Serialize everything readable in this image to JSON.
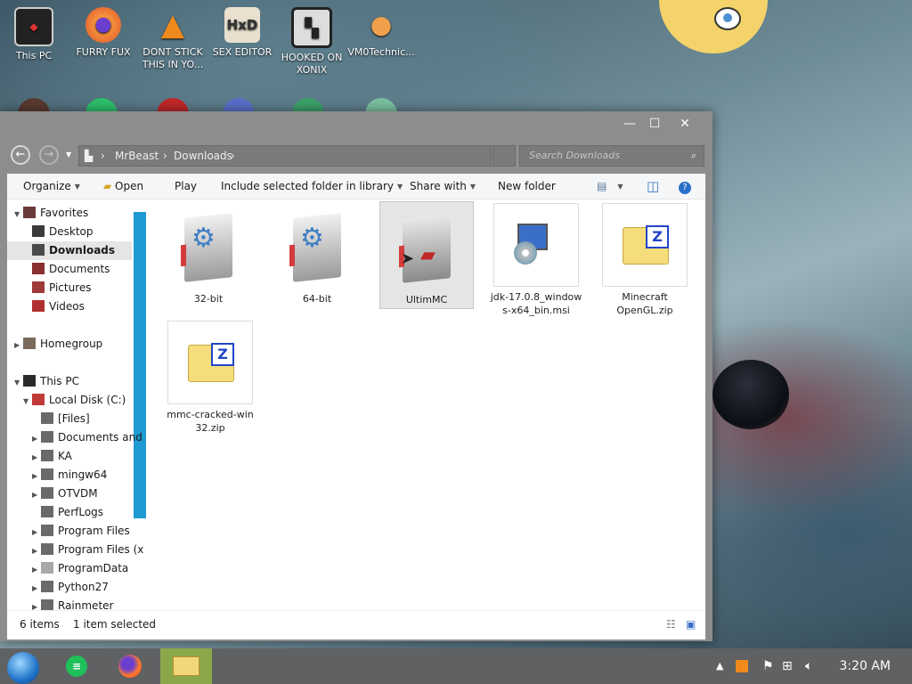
{
  "desktop": {
    "icons": [
      {
        "label": "This PC"
      },
      {
        "label": "FURRY FUX"
      },
      {
        "label": "DONT STICK THIS IN YO..."
      },
      {
        "label": "SEX EDITOR"
      },
      {
        "label": "HOOKED ON XONIX"
      },
      {
        "label": "VM0Technic..."
      }
    ]
  },
  "window": {
    "caption": {
      "minimize": "—",
      "maximize": "☐",
      "close": "✕"
    },
    "address": {
      "root": "MrBeast",
      "folder": "Downloads",
      "sep": "›"
    },
    "search_placeholder": "Search Downloads",
    "toolbar": {
      "organize": "Organize",
      "open": "Open",
      "play": "Play",
      "include": "Include selected folder in library",
      "share": "Share with",
      "new_folder": "New folder"
    },
    "tree": [
      {
        "label": "Favorites",
        "level": 0,
        "exp": "▼"
      },
      {
        "label": "Desktop",
        "level": 1,
        "exp": ""
      },
      {
        "label": "Downloads",
        "level": 1,
        "exp": "",
        "selected": true
      },
      {
        "label": "Documents",
        "level": 1,
        "exp": ""
      },
      {
        "label": "Pictures",
        "level": 1,
        "exp": ""
      },
      {
        "label": "Videos",
        "level": 1,
        "exp": ""
      },
      {
        "label": "Homegroup",
        "level": 0,
        "exp": "▶"
      },
      {
        "label": "This PC",
        "level": 0,
        "exp": "▼"
      },
      {
        "label": "Local Disk (C:)",
        "level": 1,
        "exp": "▼"
      },
      {
        "label": "[Files]",
        "level": 2,
        "exp": ""
      },
      {
        "label": "Documents and",
        "level": 2,
        "exp": "▶"
      },
      {
        "label": "KA",
        "level": 2,
        "exp": "▶"
      },
      {
        "label": "mingw64",
        "level": 2,
        "exp": "▶"
      },
      {
        "label": "OTVDM",
        "level": 2,
        "exp": "▶"
      },
      {
        "label": "PerfLogs",
        "level": 2,
        "exp": ""
      },
      {
        "label": "Program Files",
        "level": 2,
        "exp": "▶"
      },
      {
        "label": "Program Files (x",
        "level": 2,
        "exp": "▶"
      },
      {
        "label": "ProgramData",
        "level": 2,
        "exp": "▶"
      },
      {
        "label": "Python27",
        "level": 2,
        "exp": "▶"
      },
      {
        "label": "Rainmeter",
        "level": 2,
        "exp": "▶"
      }
    ],
    "files": [
      {
        "name": "32-bit",
        "icon": "setup-icon"
      },
      {
        "name": "64-bit",
        "icon": "setup-icon"
      },
      {
        "name": "UltimMC",
        "icon": "app-icon",
        "selected": true
      },
      {
        "name": "jdk-17.0.8_windows-x64_bin.msi",
        "icon": "installer-icon"
      },
      {
        "name": "Minecraft OpenGL.zip",
        "icon": "zip-icon"
      },
      {
        "name": "mmc-cracked-win32.zip",
        "icon": "zip-icon"
      }
    ],
    "status": {
      "count": "6 items",
      "selection": "1 item selected"
    }
  },
  "taskbar": {
    "clock": "3:20 AM",
    "apps": [
      "sheets-icon",
      "firefox-icon",
      "file-explorer-icon"
    ]
  },
  "colors": {
    "accent": "#1f9ad2",
    "taskbar": "#5f6163",
    "active_app": "#8aa84a"
  }
}
